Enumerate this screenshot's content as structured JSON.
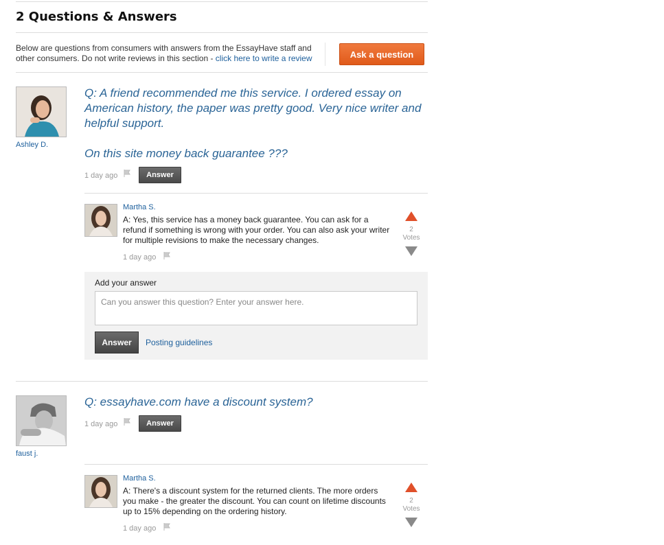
{
  "header": {
    "title": "2 Questions & Answers",
    "intro_text": "Below are questions from consumers with answers from the EssayHave staff and other consumers. Do not write reviews in this section - ",
    "intro_link": "click here to write a review",
    "ask_button": "Ask a question"
  },
  "questions": [
    {
      "user": "Ashley D.",
      "text_line1": "Q: A friend recommended me this service. I ordered essay on American history, the paper was pretty good. Very nice writer and helpful support.",
      "text_line2": "On this site money back guarantee ???",
      "time": "1 day ago",
      "answer_button": "Answer",
      "answer": {
        "user": "Martha S.",
        "text": "A: Yes, this service has a money back guarantee. You can ask for a refund if something is wrong with your order. You can also ask your writer for multiple revisions to make the necessary changes.",
        "time": "1 day ago",
        "votes": "2",
        "votes_label": "Votes"
      }
    },
    {
      "user": "faust j.",
      "text_line1": "Q: essayhave.com have a discount system?",
      "time": "1 day ago",
      "answer_button": "Answer",
      "answer": {
        "user": "Martha S.",
        "text": "A: There's a discount system for the returned clients. The more orders you make - the greater the discount. You can count on lifetime discounts up to 15% depending on the ordering history.",
        "time": "1 day ago",
        "votes": "2",
        "votes_label": "Votes"
      }
    }
  ],
  "add_answer": {
    "label": "Add your answer",
    "placeholder": "Can you answer this question? Enter your answer here.",
    "submit": "Answer",
    "guidelines": "Posting guidelines"
  },
  "colors": {
    "accent": "#e05a1a",
    "link": "#1d5f9c",
    "question": "#2a6496",
    "vote_up": "#e0502a",
    "vote_down": "#8a8a8a"
  }
}
